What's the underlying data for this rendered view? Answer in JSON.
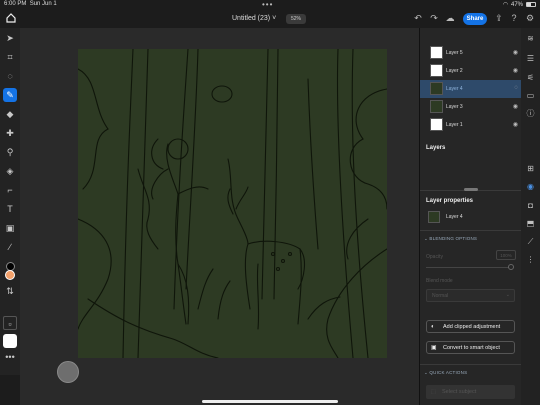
{
  "status": {
    "time": "6:00 PM",
    "date": "Sun Jun 1",
    "battery": "47%",
    "battery_level": 0.47
  },
  "topbar": {
    "title": "Untitled (23)",
    "title_chevron": "˅",
    "zoom": "52%",
    "share_label": "Share"
  },
  "layers_panel": {
    "title": "Layers",
    "layers": [
      {
        "name": "Layer 5",
        "thumb": "white"
      },
      {
        "name": "Layer 2",
        "thumb": "white"
      },
      {
        "name": "Layer 4",
        "thumb": "art"
      },
      {
        "name": "Layer 3",
        "thumb": "dark"
      },
      {
        "name": "Layer 1",
        "thumb": "white"
      }
    ],
    "selected_index": 2
  },
  "properties": {
    "title": "Layer properties",
    "layer_name": "Layer 4",
    "blending_section": "BLENDING OPTIONS",
    "opacity_label": "Opacity",
    "opacity_value": "100%",
    "blend_mode_label": "Blend mode",
    "blend_mode_value": "Normal",
    "add_clipped": "Add clipped adjustment",
    "convert_smart": "Convert to smart object",
    "quick_actions": "QUICK ACTIONS",
    "select_subject": "Select subject"
  },
  "toolbar": {
    "primary_color": "#000000",
    "secondary_color": "#f3a16b"
  },
  "colors": {
    "accent": "#1473e6",
    "canvas": "#2d3a23"
  }
}
